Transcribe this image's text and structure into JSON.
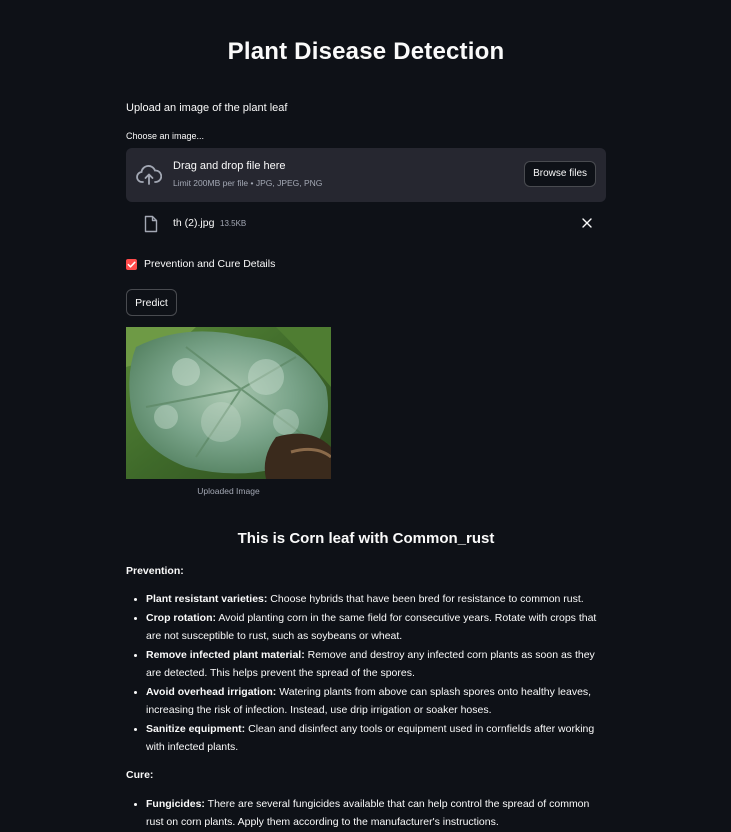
{
  "title": "Plant Disease Detection",
  "upload_label": "Upload an image of the plant leaf",
  "uploader": {
    "label": "Choose an image...",
    "drag_text": "Drag and drop file here",
    "limit_text": "Limit 200MB per file • JPG, JPEG, PNG",
    "browse_label": "Browse files"
  },
  "file": {
    "name": "th (2).jpg",
    "size": "13.5KB"
  },
  "checkbox": {
    "label": "Prevention and Cure Details",
    "checked": true
  },
  "predict_label": "Predict",
  "image_caption": "Uploaded Image",
  "result_heading": "This is Corn leaf with Common_rust",
  "prevention": {
    "heading": "Prevention:",
    "items": [
      {
        "title": "Plant resistant varieties:",
        "text": " Choose hybrids that have been bred for resistance to common rust."
      },
      {
        "title": "Crop rotation:",
        "text": " Avoid planting corn in the same field for consecutive years. Rotate with crops that are not susceptible to rust, such as soybeans or wheat."
      },
      {
        "title": "Remove infected plant material:",
        "text": " Remove and destroy any infected corn plants as soon as they are detected. This helps prevent the spread of the spores."
      },
      {
        "title": "Avoid overhead irrigation:",
        "text": " Watering plants from above can splash spores onto healthy leaves, increasing the risk of infection. Instead, use drip irrigation or soaker hoses."
      },
      {
        "title": "Sanitize equipment:",
        "text": " Clean and disinfect any tools or equipment used in cornfields after working with infected plants."
      }
    ]
  },
  "cure": {
    "heading": "Cure:",
    "items": [
      {
        "title": "Fungicides:",
        "text": " There are several fungicides available that can help control the spread of common rust on corn plants. Apply them according to the manufacturer's instructions."
      }
    ]
  },
  "colors": {
    "background": "#0e1117",
    "surface": "#262730",
    "accent": "#ff4b4b",
    "text": "#fafafa",
    "muted": "#a3a8b4"
  }
}
